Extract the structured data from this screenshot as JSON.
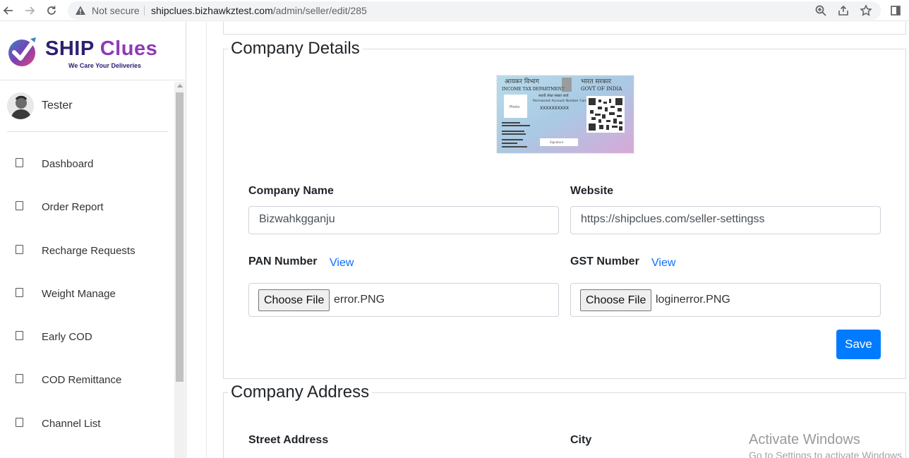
{
  "browser": {
    "security_label": "Not secure",
    "url_host": "shipclues.bizhawkztest.com",
    "url_path": "/admin/seller/edit/285"
  },
  "sidebar": {
    "logo": {
      "brand_ship": "SHIP",
      "brand_clues": "Clues",
      "tagline": "We Care Your Deliveries"
    },
    "user_name": "Tester",
    "items": [
      {
        "label": "Dashboard"
      },
      {
        "label": "Order Report"
      },
      {
        "label": "Recharge Requests"
      },
      {
        "label": "Weight Manage"
      },
      {
        "label": "Early COD"
      },
      {
        "label": "COD Remittance"
      },
      {
        "label": "Channel List"
      }
    ]
  },
  "company_details": {
    "legend": "Company Details",
    "pan_card_image": {
      "dept_hindi": "आयकर विभाग",
      "govt_hindi": "भारत सरकार",
      "dept": "INCOME TAX DEPARTMENT",
      "govt": "GOVT OF INDIA",
      "card_hindi": "स्थायी लेखा संख्या कार्ड",
      "card_title": "Permanent Account Number Card",
      "pan": "XXXXXXXXXX",
      "photo": "Photo",
      "signature": "Signature"
    },
    "company_name_label": "Company Name",
    "company_name_value": "Bizwahkgganju",
    "website_label": "Website",
    "website_value": "https://shipclues.com/seller-settingss",
    "pan_label": "PAN Number",
    "pan_view": "View",
    "pan_file_button": "Choose File",
    "pan_file_name": "error.PNG",
    "gst_label": "GST Number",
    "gst_view": "View",
    "gst_file_button": "Choose File",
    "gst_file_name": "loginerror.PNG",
    "save_label": "Save",
    "accent_color": "#007bff"
  },
  "company_address": {
    "legend": "Company Address",
    "street_label": "Street Address",
    "city_label": "City"
  },
  "os_watermark": {
    "line1": "Activate Windows",
    "line2": "Go to Settings to activate Windows."
  }
}
